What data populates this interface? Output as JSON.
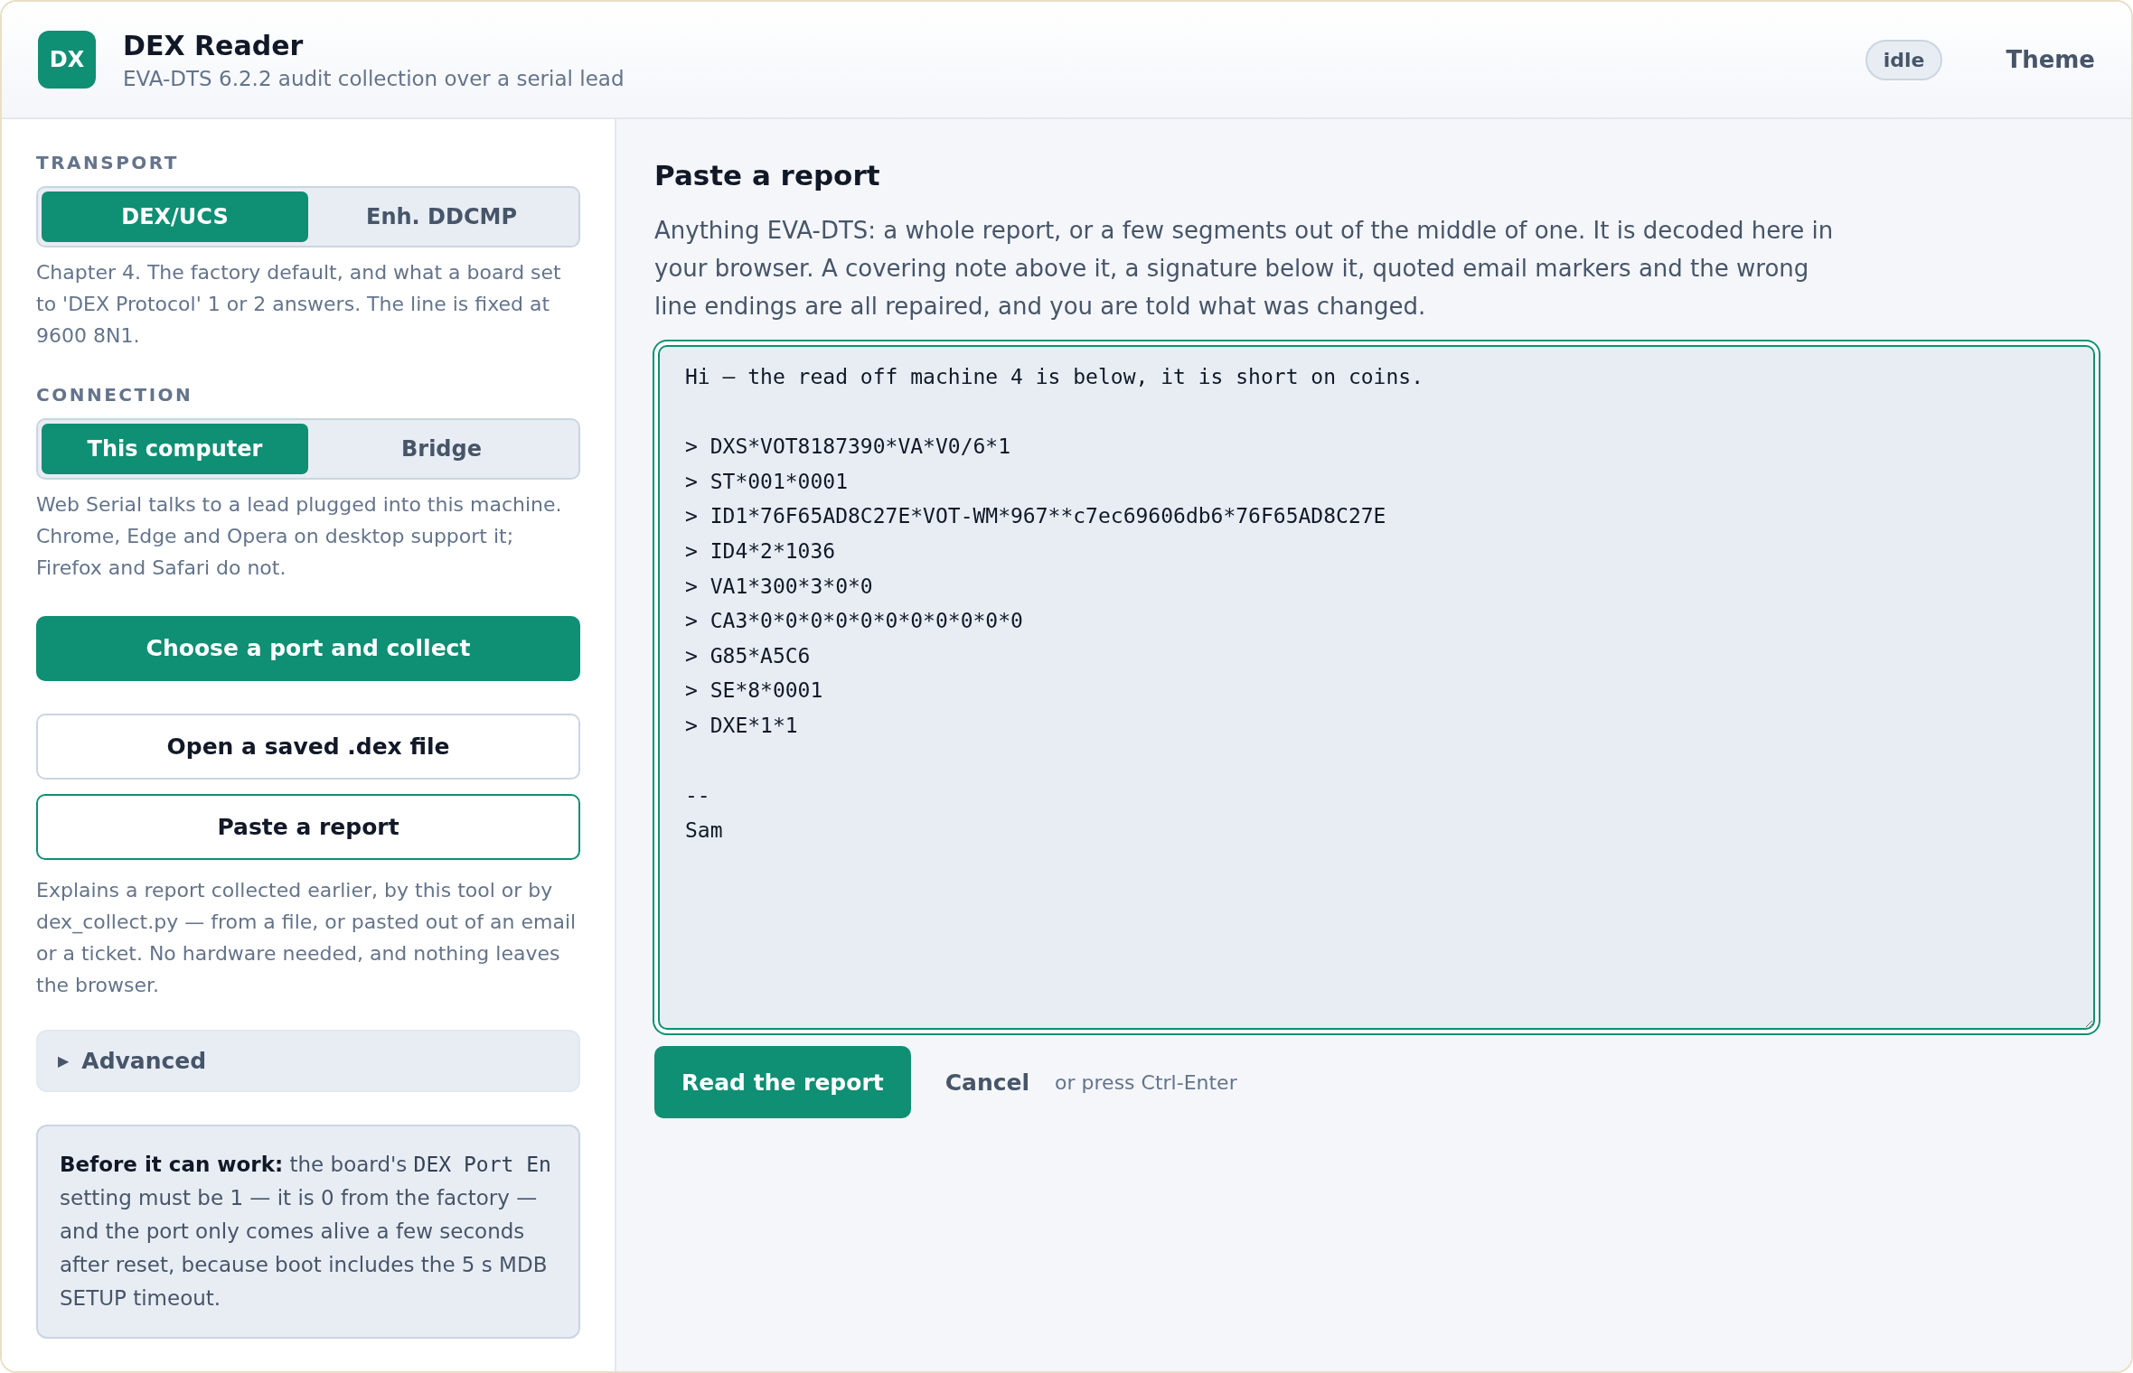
{
  "header": {
    "logo": "DX",
    "title": "DEX Reader",
    "subtitle": "EVA-DTS 6.2.2 audit collection over a serial lead",
    "status": "idle",
    "theme_button": "Theme"
  },
  "sidebar": {
    "sections": [
      {
        "label": "TRANSPORT",
        "options": [
          {
            "label": "DEX/UCS",
            "selected": true
          },
          {
            "label": "Enh. DDCMP",
            "selected": false
          }
        ],
        "description": "Chapter 4. The factory default, and what a board set to 'DEX Protocol' 1 or 2 answers. The line is fixed at 9600 8N1."
      },
      {
        "label": "CONNECTION",
        "options": [
          {
            "label": "This computer",
            "selected": true
          },
          {
            "label": "Bridge",
            "selected": false
          }
        ],
        "description": "Web Serial talks to a lead plugged into this machine. Chrome, Edge and Opera on desktop support it; Firefox and Safari do not."
      }
    ],
    "actions": [
      {
        "label": "Choose a port and collect",
        "kind": "primary"
      },
      {
        "label": "Open a saved .dex file",
        "kind": "secondary",
        "selected": false
      },
      {
        "label": "Paste a report",
        "kind": "secondary",
        "selected": true
      }
    ],
    "actions_note": "Explains a report collected earlier, by this tool or by dex_collect.py — from a file, or pasted out of an email or a ticket. No hardware needed, and nothing leaves the browser.",
    "advanced": {
      "marker": "▶",
      "label": "Advanced"
    },
    "note": {
      "lead": "**Before it can work:** the board's",
      "code": "DEX Port En",
      "rest": "setting must be 1 — it is 0 from the factory — and the port only comes alive a few seconds after reset, because boot includes the 5 s MDB SETUP timeout."
    }
  },
  "main": {
    "title": "Paste a report",
    "intro": "Anything EVA-DTS: a whole report, or a few segments out of the middle of one. It is decoded here in your browser. A covering note above it, a signature below it, quoted email markers and the wrong line endings are all repaired, and you are told what was changed.",
    "report": {
      "value": "Hi — the read off machine 4 is below, it is short on coins.\n\n> DXS*VOT8187390*VA*V0/6*1\n> ST*001*0001\n> ID1*76F65AD8C27E*VOT-WM*967**c7ec69606db6*76F65AD8C27E\n> ID4*2*1036\n> VA1*300*3*0*0\n> CA3*0*0*0*0*0*0*0*0*0*0*0\n> G85*A5C6\n> SE*8*0001\n> DXE*1*1\n\n--\nSam",
      "focused": true
    },
    "read_button": "Read the report",
    "cancel_button": "Cancel",
    "hint": "or press Ctrl-Enter"
  }
}
